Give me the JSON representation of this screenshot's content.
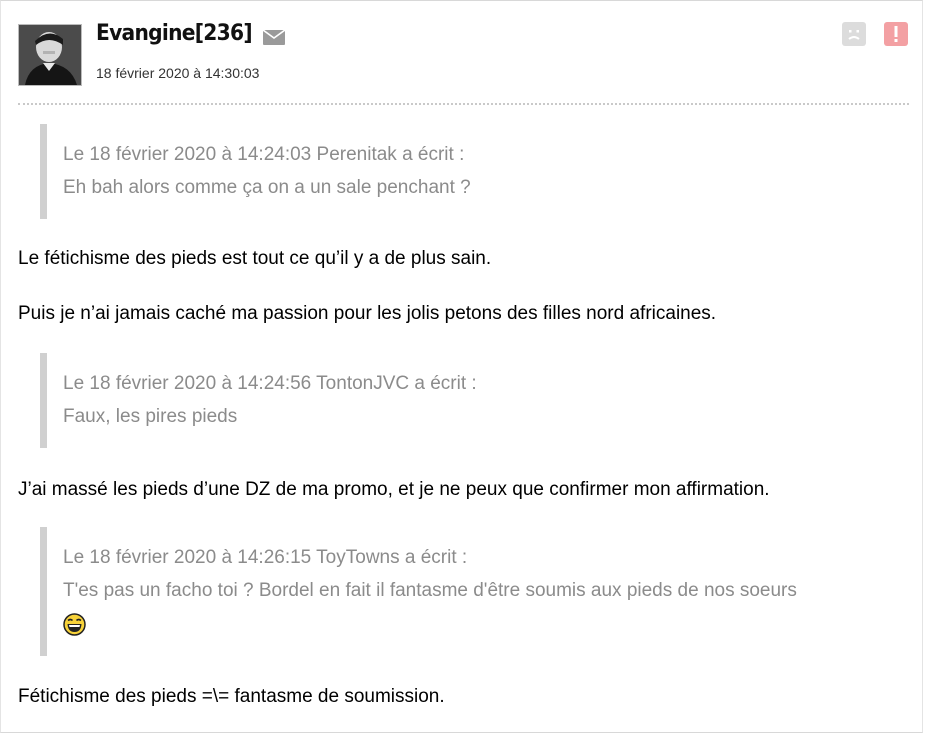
{
  "post": {
    "author": "Evangine[236]",
    "date": "18 février 2020 à 14:30:03",
    "icons": {
      "message": "mail-icon",
      "report_sad": "sad-face-icon",
      "report_alert": "alert-icon"
    },
    "blocks": [
      {
        "type": "quote",
        "header": "Le 18 février 2020 à 14:24:03 Perenitak a écrit :",
        "lines": [
          "Eh bah alors comme ça on a un sale penchant ?"
        ]
      },
      {
        "type": "paragraph",
        "text": "Le fétichisme des pieds est tout ce qu’il y a de plus sain."
      },
      {
        "type": "paragraph",
        "text": "Puis je n’ai jamais caché ma passion pour les jolis petons des filles nord africaines."
      },
      {
        "type": "quote",
        "header": "Le 18 février 2020 à 14:24:56 TontonJVC a écrit :",
        "lines": [
          "Faux, les pires pieds"
        ]
      },
      {
        "type": "paragraph",
        "text": "J’ai massé les pieds d’une DZ de ma promo, et je ne peux que confirmer mon affirmation."
      },
      {
        "type": "quote",
        "header": "Le 18 février 2020 à 14:26:15 ToyTowns a écrit :",
        "lines": [
          "T'es pas un facho toi ? Bordel en fait il fantasme d'être soumis aux pieds de nos soeurs"
        ],
        "smiley": "laughing-smiley-icon"
      },
      {
        "type": "paragraph",
        "text": "Fétichisme des pieds =\\= fantasme de soumission."
      }
    ]
  },
  "colors": {
    "quote_text": "#8b8b8b",
    "quote_bar": "#d0d0d0",
    "alert_red": "#f3a0a3",
    "icon_grey": "#c8c8c8"
  }
}
